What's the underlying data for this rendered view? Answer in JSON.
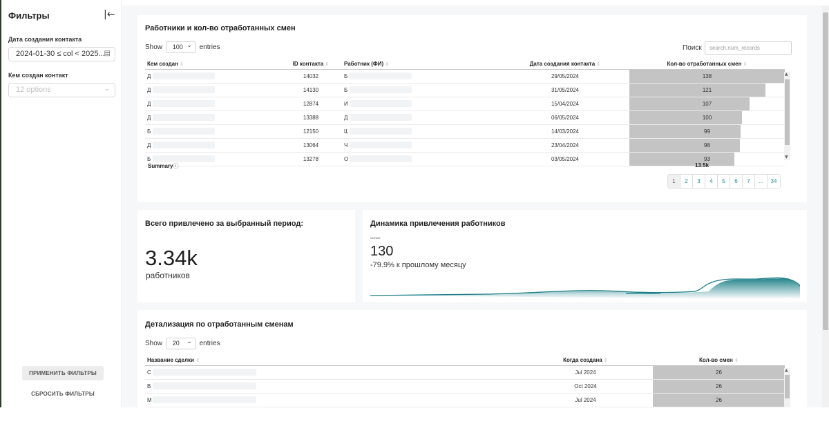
{
  "sidebar": {
    "title": "Фильтры",
    "collapse_icon": "|←",
    "date_label": "Дата создания контакта",
    "date_value": "2024-01-30 ≤ col < 2025...",
    "creator_label": "Кем создан контакт",
    "creator_placeholder": "12 options",
    "apply_label": "ПРИМЕНИТЬ ФИЛЬТРЫ",
    "reset_label": "СБРОСИТЬ ФИЛЬТРЫ"
  },
  "workers": {
    "title": "Работники и кол-во отработанных смен",
    "show_label": "Show",
    "entries_value": "100",
    "entries_label": "entries",
    "search_label": "Поиск",
    "search_placeholder": "search.num_records",
    "columns": [
      "Кем создан",
      "ID контакта",
      "Работник (ФИ)",
      "Дата создания контакта",
      "Кол-во отработанных смен"
    ],
    "rows": [
      {
        "creator": "Д",
        "id": "14032",
        "worker": "Б",
        "date": "29/05/2024",
        "shifts": "138",
        "frac": 1.0
      },
      {
        "creator": "Д",
        "id": "14130",
        "worker": "Б",
        "date": "31/05/2024",
        "shifts": "121",
        "frac": 0.877
      },
      {
        "creator": "Д",
        "id": "12874",
        "worker": "И",
        "date": "15/04/2024",
        "shifts": "107",
        "frac": 0.775
      },
      {
        "creator": "Д",
        "id": "13388",
        "worker": "Д",
        "date": "06/05/2024",
        "shifts": "100",
        "frac": 0.725
      },
      {
        "creator": "Б",
        "id": "12150",
        "worker": "Ш",
        "date": "14/03/2024",
        "shifts": "99",
        "frac": 0.717
      },
      {
        "creator": "Д",
        "id": "13064",
        "worker": "Ч",
        "date": "23/04/2024",
        "shifts": "98",
        "frac": 0.71
      },
      {
        "creator": "Б",
        "id": "13278",
        "worker": "О",
        "date": "03/05/2024",
        "shifts": "93",
        "frac": 0.674
      }
    ],
    "summary_label": "Summary",
    "summary_value": "13.5k",
    "pages": [
      "1",
      "2",
      "3",
      "4",
      "5",
      "6",
      "7",
      "...",
      "34"
    ]
  },
  "total": {
    "title": "Всего привлечено за выбранный период:",
    "value": "3.34k",
    "unit": "работников"
  },
  "trend": {
    "title": "Динамика привлечения работников",
    "date": "01/2025",
    "value": "130",
    "change": "-79.9% к прошлому месяцу",
    "line_color": "#1a7f87"
  },
  "details": {
    "title": "Детализация по отработанным сменам",
    "show_label": "Show",
    "entries_value": "20",
    "entries_label": "entries",
    "columns": [
      "Название сделки",
      "Когда создана",
      "Кол-во смен"
    ],
    "rows": [
      {
        "name": "С",
        "created": "Jul 2024",
        "shifts": "26"
      },
      {
        "name": "В",
        "created": "Oct 2024",
        "shifts": "26"
      },
      {
        "name": "М",
        "created": "Jul 2024",
        "shifts": "26"
      }
    ]
  }
}
